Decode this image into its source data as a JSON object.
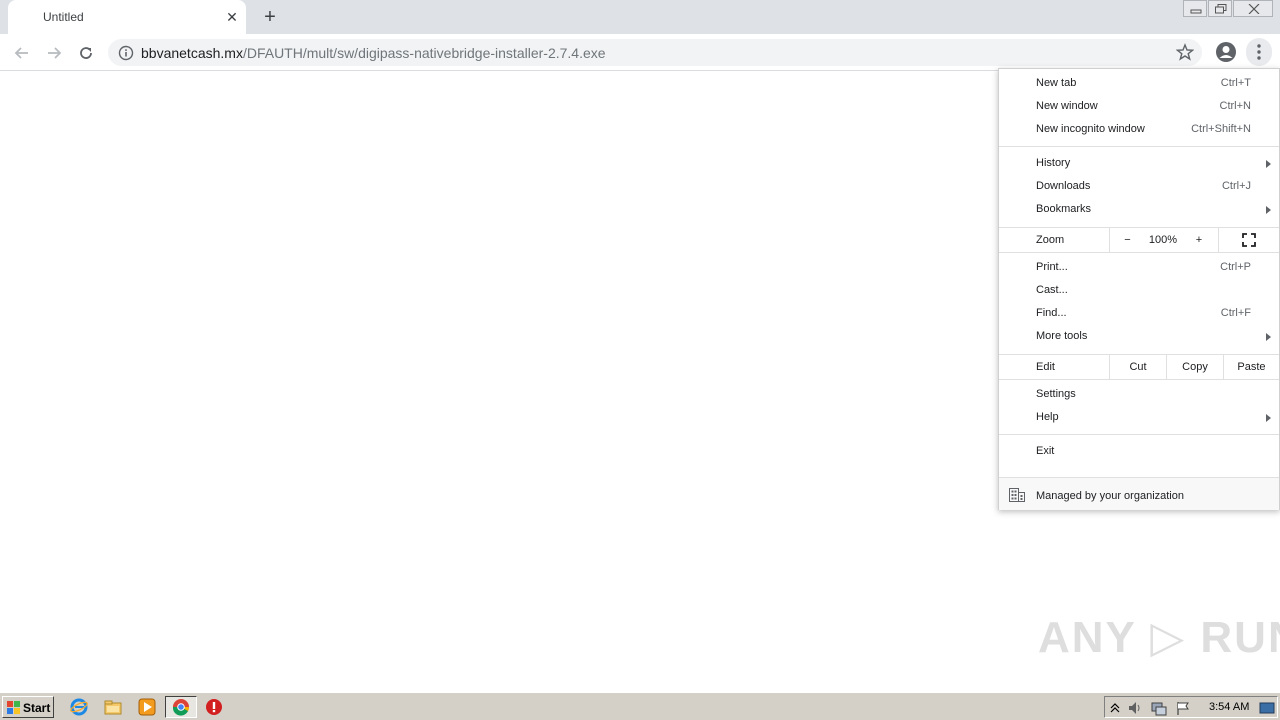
{
  "browser": {
    "tab_title": "Untitled",
    "url_host": "bbvanetcash.mx",
    "url_path": "/DFAUTH/mult/sw/digipass-nativebridge-installer-2.7.4.exe"
  },
  "menu": {
    "new_tab": {
      "label": "New tab",
      "shortcut": "Ctrl+T"
    },
    "new_window": {
      "label": "New window",
      "shortcut": "Ctrl+N"
    },
    "new_incognito": {
      "label": "New incognito window",
      "shortcut": "Ctrl+Shift+N"
    },
    "history": {
      "label": "History"
    },
    "downloads": {
      "label": "Downloads",
      "shortcut": "Ctrl+J"
    },
    "bookmarks": {
      "label": "Bookmarks"
    },
    "zoom": {
      "label": "Zoom",
      "minus": "−",
      "level": "100%",
      "plus": "+"
    },
    "print": {
      "label": "Print...",
      "shortcut": "Ctrl+P"
    },
    "cast": {
      "label": "Cast..."
    },
    "find": {
      "label": "Find...",
      "shortcut": "Ctrl+F"
    },
    "more_tools": {
      "label": "More tools"
    },
    "edit": {
      "label": "Edit",
      "cut": "Cut",
      "copy": "Copy",
      "paste": "Paste"
    },
    "settings": {
      "label": "Settings"
    },
    "help": {
      "label": "Help"
    },
    "exit": {
      "label": "Exit"
    },
    "managed": {
      "label": "Managed by your organization"
    }
  },
  "watermark": {
    "text": "ANY ▷ RUN"
  },
  "taskbar": {
    "start_label": "Start",
    "clock": "3:54 AM"
  },
  "colors": {
    "tabstrip": "#dee1e6",
    "omnibox": "#f1f3f4",
    "taskbar": "#d4d0c8"
  }
}
